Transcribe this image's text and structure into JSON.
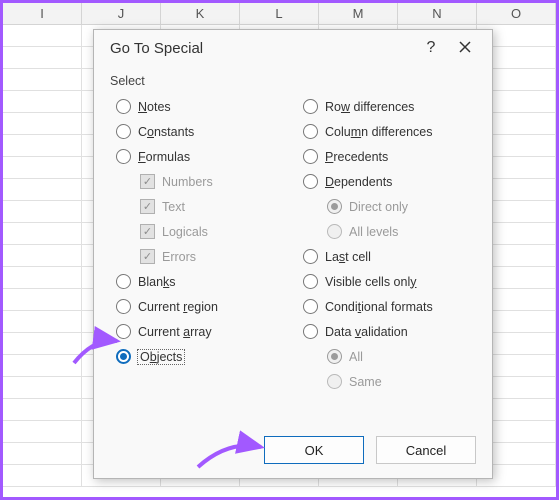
{
  "sheet": {
    "columns": [
      "I",
      "J",
      "K",
      "L",
      "M",
      "N",
      "O"
    ]
  },
  "dialog": {
    "title": "Go To Special",
    "section": "Select",
    "left": {
      "notes": "Notes",
      "constants": "Constants",
      "formulas": "Formulas",
      "numbers": "Numbers",
      "text": "Text",
      "logicals": "Logicals",
      "errors": "Errors",
      "blanks": "Blanks",
      "current_region": "Current region",
      "current_array": "Current array",
      "objects": "Objects"
    },
    "right": {
      "row_diff": "Row differences",
      "col_diff": "Column differences",
      "precedents": "Precedents",
      "dependents": "Dependents",
      "direct_only": "Direct only",
      "all_levels": "All levels",
      "last_cell": "Last cell",
      "visible": "Visible cells only",
      "cond_fmt": "Conditional formats",
      "data_val": "Data validation",
      "all": "All",
      "same": "Same"
    },
    "buttons": {
      "ok": "OK",
      "cancel": "Cancel"
    }
  }
}
